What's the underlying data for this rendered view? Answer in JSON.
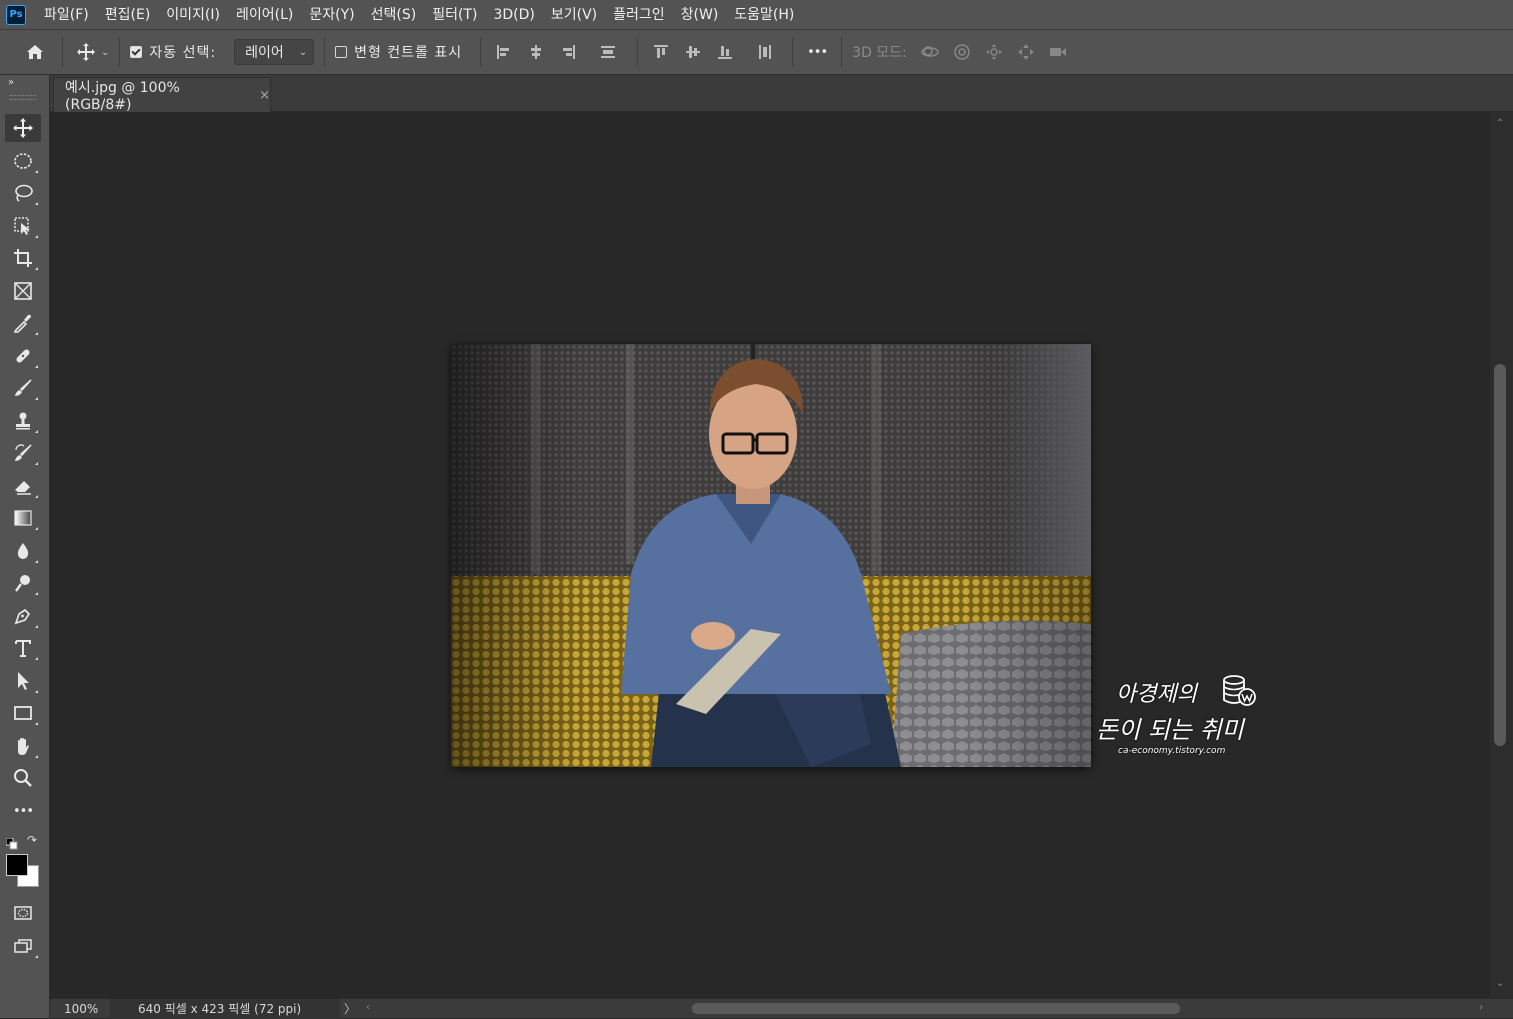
{
  "app": {
    "logo": "Ps"
  },
  "menu": [
    "파일(F)",
    "편집(E)",
    "이미지(I)",
    "레이어(L)",
    "문자(Y)",
    "선택(S)",
    "필터(T)",
    "3D(D)",
    "보기(V)",
    "플러그인",
    "창(W)",
    "도움말(H)"
  ],
  "options": {
    "auto_select_label": "자동 선택:",
    "auto_select_checked": true,
    "auto_select_target": "레이어",
    "transform_controls_label": "변형 컨트롤 표시",
    "transform_controls_checked": false,
    "more": "•••",
    "mode_3d_label": "3D 모드:"
  },
  "tools": [
    "move-tool",
    "elliptical-marquee-tool",
    "lasso-tool",
    "object-selection-tool",
    "crop-tool",
    "frame-tool",
    "eyedropper-tool",
    "healing-brush-tool",
    "brush-tool",
    "clone-stamp-tool",
    "history-brush-tool",
    "eraser-tool",
    "gradient-tool",
    "blur-tool",
    "dodge-tool",
    "pen-tool",
    "type-tool",
    "path-selection-tool",
    "rectangle-tool",
    "hand-tool",
    "zoom-tool",
    "edit-toolbar"
  ],
  "tools_more": "•••",
  "colors": {
    "foreground": "#000000",
    "background": "#ffffff",
    "accent": "#31a8ff"
  },
  "document": {
    "tab_title": "예시.jpg @ 100% (RGB/8#)",
    "close": "×"
  },
  "watermark": {
    "line1": "아경제의",
    "line2": "돈이 되는 취미",
    "url": "ca-economy.tistory.com"
  },
  "status": {
    "zoom": "100%",
    "doc_info": "640 픽셀 x 423 픽셀 (72 ppi)",
    "arrow": "〉"
  }
}
